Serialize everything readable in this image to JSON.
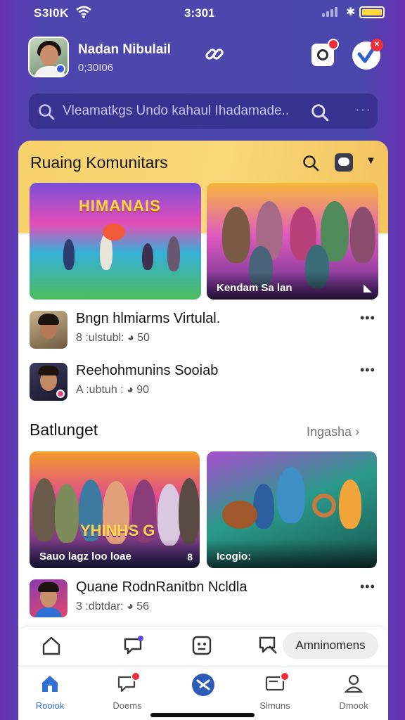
{
  "status_bar": {
    "carrier": "S3I0K",
    "time": "3:301"
  },
  "profile": {
    "name": "Nadan Nibulail",
    "handle": "0;30I06"
  },
  "search": {
    "placeholder": "Vleamatkgs Undo kahaul Ihadamade.."
  },
  "section1": {
    "title": "Ruaing Komunitars",
    "tile1_banner": "HIMANAIS",
    "tile2_caption": "Kendam Sa lan",
    "items": [
      {
        "title": "Bngn hlmiarms Virtulal.",
        "meta": "8 :ulstubl:",
        "count": "50"
      },
      {
        "title": "Reehohmunins Sooiab",
        "meta": "A :ubtuh :",
        "count": "90"
      }
    ]
  },
  "section2": {
    "title": "Batlunget",
    "link": "Ingasha",
    "tile3_banner": "YHINHS G",
    "tile3_caption": "Sauo lagz loo loae",
    "tile3_count": "8",
    "tile4_caption": "Icogio:",
    "items": [
      {
        "title": "Quane RodnRanitbn Ncldla",
        "meta": "3 :dbtdar:",
        "count": "56"
      }
    ]
  },
  "quickbar": {
    "pill_label": "Amninomens"
  },
  "tabs": [
    {
      "label": "Rooiok",
      "icon": "home-icon",
      "active": true
    },
    {
      "label": "Doems",
      "icon": "chat-icon",
      "active": false
    },
    {
      "label": "",
      "icon": "center-logo-icon",
      "active": false
    },
    {
      "label": "Slmuns",
      "icon": "mail-icon",
      "active": false
    },
    {
      "label": "Dmook",
      "icon": "profile-icon",
      "active": false
    }
  ],
  "colors": {
    "accent": "#2f6fd6",
    "badge": "#ef2e3a",
    "header_yellow": "#f7d16a",
    "bg_purple": "#4a48ad"
  }
}
